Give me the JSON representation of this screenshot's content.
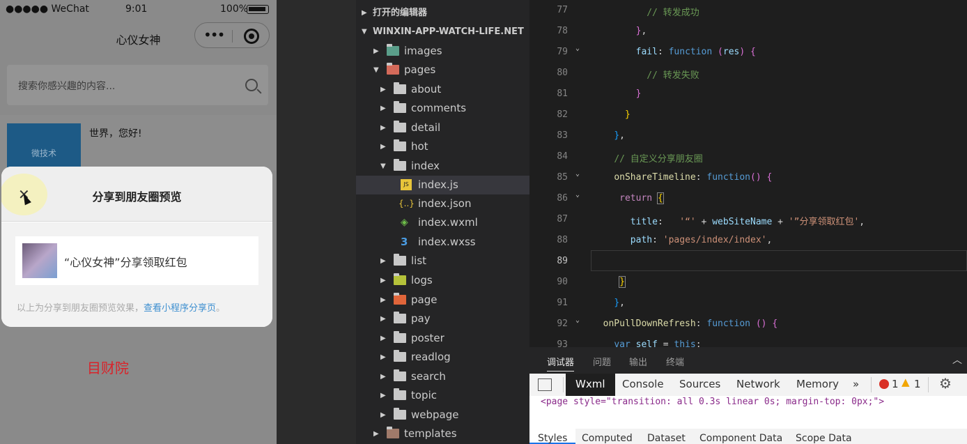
{
  "phone": {
    "status": {
      "carrier": "●●●●● WeChat",
      "time": "9:01",
      "battery": "100%"
    },
    "nav_title": "心仪女神",
    "capsule_dots": "•••",
    "search_placeholder": "搜索你感兴趣的内容...",
    "card": {
      "thumb_text": "微技术",
      "title": "世界，您好!"
    },
    "modal": {
      "close": "✕",
      "title": "分享到朋友圈预览",
      "share_text": "“心仪女神”分享领取红包",
      "footer_text": "以上为分享到朋友圈预览效果，",
      "footer_link": "查看小程序分享页",
      "footer_end": "。"
    },
    "watermark": "目财院"
  },
  "explorer": {
    "sections": [
      "打开的编辑器",
      "WINXIN-APP-WATCH-LIFE.NET"
    ],
    "items": [
      {
        "name": "images",
        "twisty": "▶"
      },
      {
        "name": "pages",
        "twisty": "▼"
      },
      {
        "name": "about",
        "twisty": "▶"
      },
      {
        "name": "comments",
        "twisty": "▶"
      },
      {
        "name": "detail",
        "twisty": "▶"
      },
      {
        "name": "hot",
        "twisty": "▶"
      },
      {
        "name": "index",
        "twisty": "▼"
      },
      {
        "name": "index.js",
        "twisty": "",
        "icon": "JS"
      },
      {
        "name": "index.json",
        "twisty": "",
        "icon": "{..}"
      },
      {
        "name": "index.wxml",
        "twisty": "",
        "icon": "◈"
      },
      {
        "name": "index.wxss",
        "twisty": "",
        "icon": "3"
      },
      {
        "name": "list",
        "twisty": "▶"
      },
      {
        "name": "logs",
        "twisty": "▶"
      },
      {
        "name": "page",
        "twisty": "▶"
      },
      {
        "name": "pay",
        "twisty": "▶"
      },
      {
        "name": "poster",
        "twisty": "▶"
      },
      {
        "name": "readlog",
        "twisty": "▶"
      },
      {
        "name": "search",
        "twisty": "▶"
      },
      {
        "name": "topic",
        "twisty": "▶"
      },
      {
        "name": "webpage",
        "twisty": "▶"
      },
      {
        "name": "templates",
        "twisty": "▶"
      }
    ]
  },
  "editor": {
    "line_numbers": [
      "77",
      "78",
      "79",
      "80",
      "81",
      "82",
      "83",
      "84",
      "85",
      "86",
      "87",
      "88",
      "89",
      "90",
      "91",
      "92",
      "93"
    ]
  },
  "devtools": {
    "panel_tabs": [
      "调试器",
      "问题",
      "输出",
      "终端"
    ],
    "tool_tabs": [
      "Wxml",
      "Console",
      "Sources",
      "Network",
      "Memory"
    ],
    "more": "»",
    "errors": "1",
    "warnings": "1",
    "code_line": "<page style=\"transition: all 0.3s linear 0s; margin-top: 0px;\">",
    "sub_tabs": [
      "Styles",
      "Computed",
      "Dataset",
      "Component Data",
      "Scope Data"
    ]
  }
}
